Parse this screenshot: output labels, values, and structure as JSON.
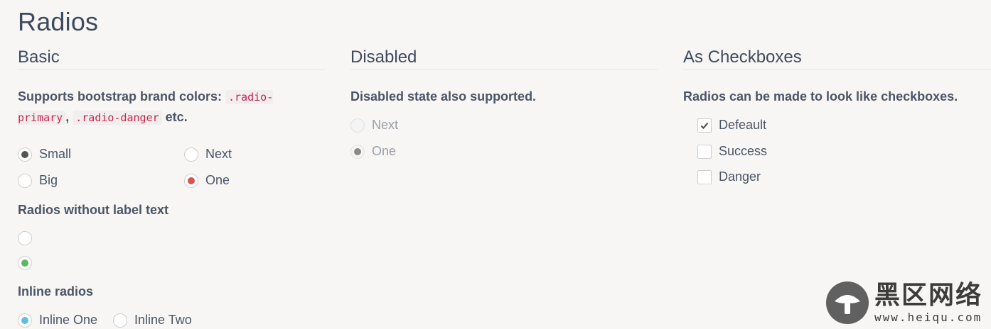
{
  "title": "Radios",
  "basic": {
    "heading": "Basic",
    "lead_prefix": "Supports bootstrap brand colors: ",
    "code1": ".radio-primary",
    "code1_a": ".radio-",
    "code1_b": "primary",
    "comma": ",",
    "code2": ".radio-danger",
    "lead_suffix": "etc.",
    "radios": [
      {
        "label": "Small",
        "checked": true,
        "color": "#555555"
      },
      {
        "label": "Next",
        "checked": false
      },
      {
        "label": "Big",
        "checked": false
      },
      {
        "label": "One",
        "checked": true,
        "color": "#d9534f"
      }
    ],
    "no_label_title": "Radios without label text",
    "no_label_radios": [
      {
        "checked": false
      },
      {
        "checked": true,
        "color": "#5cb85c"
      }
    ],
    "inline_title": "Inline radios",
    "inline_radios": [
      {
        "label": "Inline One",
        "checked": true,
        "color": "#5bc0de"
      },
      {
        "label": "Inline Two",
        "checked": false
      }
    ]
  },
  "disabled": {
    "heading": "Disabled",
    "lead": "Disabled state also supported.",
    "radios": [
      {
        "label": "Next",
        "checked": false
      },
      {
        "label": "One",
        "checked": true,
        "color": "#8a8a8a"
      }
    ]
  },
  "checkboxes": {
    "heading": "As Checkboxes",
    "lead": "Radios can be made to look like checkboxes.",
    "items": [
      {
        "label": "Defeault",
        "checked": true
      },
      {
        "label": "Success",
        "checked": false
      },
      {
        "label": "Danger",
        "checked": false
      }
    ]
  },
  "watermark": {
    "cn": "黑区网络",
    "url": "www.heiqu.com"
  }
}
